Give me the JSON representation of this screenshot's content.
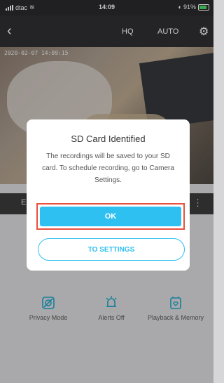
{
  "status_bar": {
    "carrier": "dtac",
    "time": "14:09",
    "battery": "91%"
  },
  "nav": {
    "back_icon": "chevron-left-icon",
    "hq_label": "HQ",
    "auto_label": "AUTO",
    "settings_icon": "gear-icon"
  },
  "video": {
    "timestamp": "2020-02-07 14:09:15"
  },
  "controls": {
    "left_text": "E",
    "right_icon": "more-vertical-icon"
  },
  "dialog": {
    "title": "SD Card Identified",
    "body": "The recordings will be saved to your SD card. To schedule recording, go to Camera Settings.",
    "ok_label": "OK",
    "settings_label": "TO SETTINGS"
  },
  "features": [
    {
      "label": "Privacy Mode",
      "icon": "privacy-icon"
    },
    {
      "label": "Alerts Off",
      "icon": "alert-bell-icon"
    },
    {
      "label": "Playback & Memory",
      "icon": "playback-icon"
    }
  ],
  "colors": {
    "accent": "#2ec0f0",
    "highlight": "#e8503f"
  }
}
